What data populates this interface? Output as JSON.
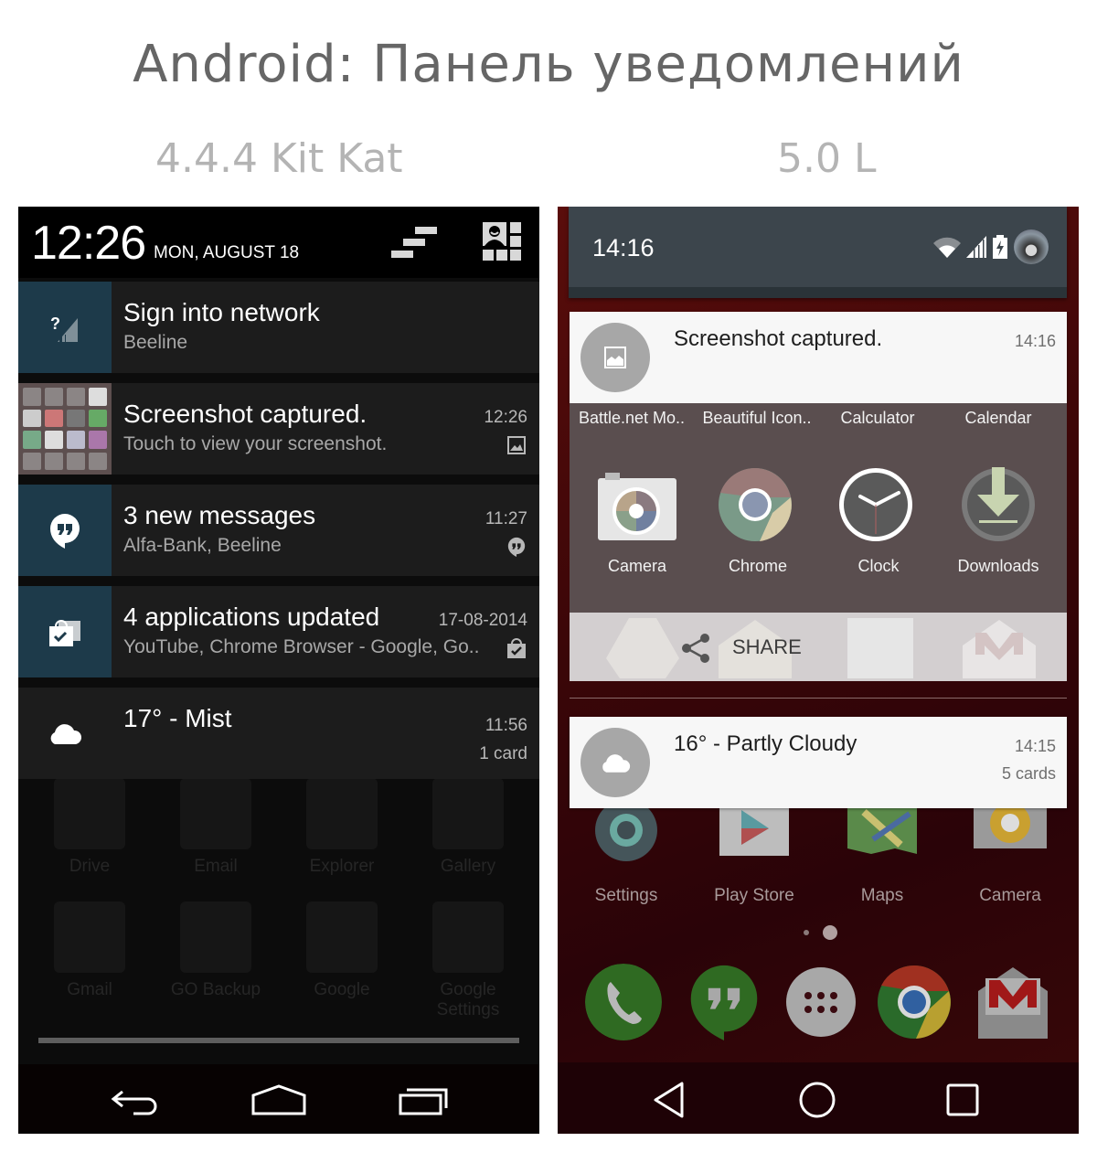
{
  "page": {
    "title": "Android: Панель уведомлений",
    "versions": [
      "4.4.4 Kit Kat",
      "5.0 L"
    ]
  },
  "kitkat": {
    "header": {
      "time": "12:26",
      "date": "MON, AUGUST 18",
      "clear_icon": "clear-all-icon",
      "quick_settings_icon": "quick-settings-icon"
    },
    "notifications": [
      {
        "icon": "signal-unknown-icon",
        "title": "Sign into network",
        "subtitle": "Beeline",
        "time": "",
        "right_text": "",
        "small_icon": ""
      },
      {
        "icon": "screenshot-thumbnail",
        "title": "Screenshot captured.",
        "subtitle": "Touch to view your screenshot.",
        "time": "12:26",
        "right_text": "",
        "small_icon": "image-icon"
      },
      {
        "icon": "hangouts-icon",
        "title": "3 new messages",
        "subtitle": "Alfa-Bank, Beeline",
        "time": "11:27",
        "right_text": "",
        "small_icon": "hangouts-icon"
      },
      {
        "icon": "play-store-bag-icon",
        "title": "4 applications updated",
        "subtitle": "YouTube, Chrome Browser - Google, Go..",
        "time": "17-08-2014",
        "right_text": "",
        "small_icon": "play-store-bag-icon"
      },
      {
        "icon": "cloud-icon",
        "title": "17° - Mist",
        "subtitle": "",
        "time": "11:56",
        "right_text": "1 card",
        "small_icon": ""
      }
    ],
    "background_apps": [
      "Drive",
      "Email",
      "Explorer",
      "Gallery",
      "Gmail",
      "GO Backup",
      "Google",
      "Google Settings"
    ],
    "navbar": [
      "back-icon",
      "home-icon",
      "recents-icon"
    ]
  },
  "lollipop": {
    "header": {
      "time": "14:16",
      "status_icons": [
        "wifi-icon",
        "cell-signal-icon",
        "battery-charging-icon",
        "avatar"
      ]
    },
    "screenshot_card": {
      "title": "Screenshot captured.",
      "time": "14:16",
      "icon": "image-icon",
      "preview_top_labels": [
        "Battle.net Mo..",
        "Beautiful Icon..",
        "Calculator",
        "Calendar"
      ],
      "preview_apps": [
        "Camera",
        "Chrome",
        "Clock",
        "Downloads"
      ],
      "action_label": "SHARE",
      "action_icon": "share-icon"
    },
    "weather_card": {
      "title": "16° - Partly Cloudy",
      "time": "14:15",
      "right_text": "5 cards",
      "icon": "cloud-icon"
    },
    "home_apps": [
      "Settings",
      "Play Store",
      "Maps",
      "Camera"
    ],
    "dock": [
      "phone-icon",
      "hangouts-icon",
      "app-drawer-icon",
      "chrome-icon",
      "gmail-icon"
    ],
    "navbar": [
      "back-icon",
      "home-icon",
      "recents-icon"
    ]
  }
}
